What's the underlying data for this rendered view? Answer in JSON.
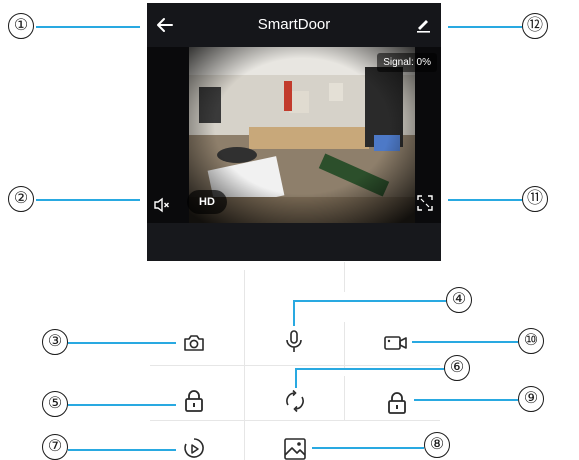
{
  "header": {
    "title": "SmartDoor"
  },
  "video": {
    "signal_label": "Signal: 0%",
    "hd_label": "HD"
  },
  "callouts": [
    "①",
    "②",
    "③",
    "④",
    "⑤",
    "⑥",
    "⑦",
    "⑧",
    "⑨",
    "⑩",
    "⑪",
    "⑫"
  ],
  "icons": {
    "back": "back-arrow-icon",
    "edit": "edit-pencil-icon",
    "mute": "speaker-muted-icon",
    "fullscreen": "fullscreen-icon",
    "snapshot": "camera-icon",
    "talk": "microphone-icon",
    "record": "video-camera-icon",
    "lock": "padlock-icon",
    "rotate": "rotate-icon",
    "playback": "playback-icon",
    "gallery": "image-icon"
  },
  "colors": {
    "leader": "#29a9e1",
    "phone_bg": "#15161a",
    "icon": "#2a2a2a"
  }
}
